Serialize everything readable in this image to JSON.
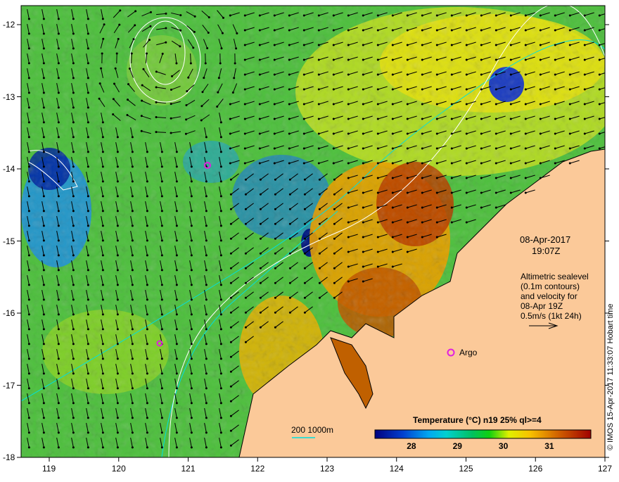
{
  "map": {
    "date": "08-Apr-2017",
    "time": "19:07Z",
    "info_lines": [
      "Altimetric sealevel",
      "(0.1m contours)",
      "and velocity for",
      "08-Apr 19Z",
      "0.5m/s (1kt 24h)"
    ],
    "argo_label": "Argo",
    "depth_label": "200  1000m",
    "colorbar_title": "Temperature (°C) n19 25% ql>=4",
    "colorbar_ticks": [
      "28",
      "29",
      "30",
      "31"
    ],
    "colorbar_range": [
      27.2,
      31.9
    ],
    "lon_ticks": [
      "119",
      "120",
      "121",
      "122",
      "123",
      "124",
      "125",
      "126",
      "127"
    ],
    "lat_ticks": [
      "-12",
      "-13",
      "-14",
      "-15",
      "-16",
      "-17",
      "-18"
    ],
    "credit": "© IMOS 15-Apr-2017 11:33:07 Hobart time",
    "colors": {
      "land": "#fbc999",
      "ocean": "#58c83c",
      "argo": "#e020e0",
      "contour": "#ffffff",
      "isobath": "#00e0e0"
    }
  }
}
